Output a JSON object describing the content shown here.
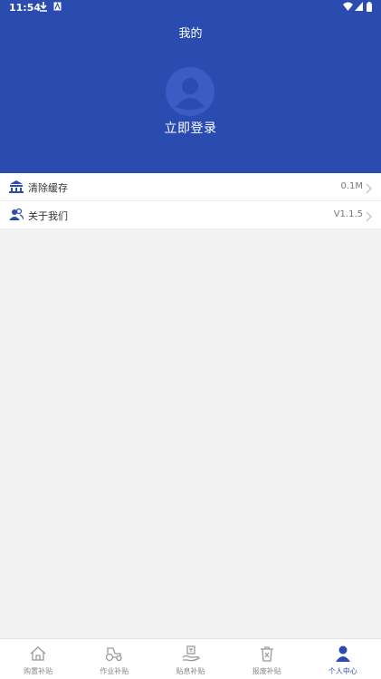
{
  "status_bar": {
    "time": "11:54"
  },
  "header": {
    "title": "我的",
    "login_label": "立即登录"
  },
  "menu": [
    {
      "label": "清除缓存",
      "value": "0.1M"
    },
    {
      "label": "关于我们",
      "value": "V1.1.5"
    }
  ],
  "tabbar": {
    "items": [
      {
        "label": "购置补贴",
        "icon": "home-icon"
      },
      {
        "label": "作业补贴",
        "icon": "tractor-icon"
      },
      {
        "label": "贴息补贴",
        "icon": "interest-icon"
      },
      {
        "label": "报废补贴",
        "icon": "recycle-bin-icon"
      },
      {
        "label": "个人中心",
        "icon": "person-icon"
      }
    ],
    "active_index": 4
  },
  "colors": {
    "primary": "#2a4cb0",
    "background": "#f2f2f2"
  }
}
